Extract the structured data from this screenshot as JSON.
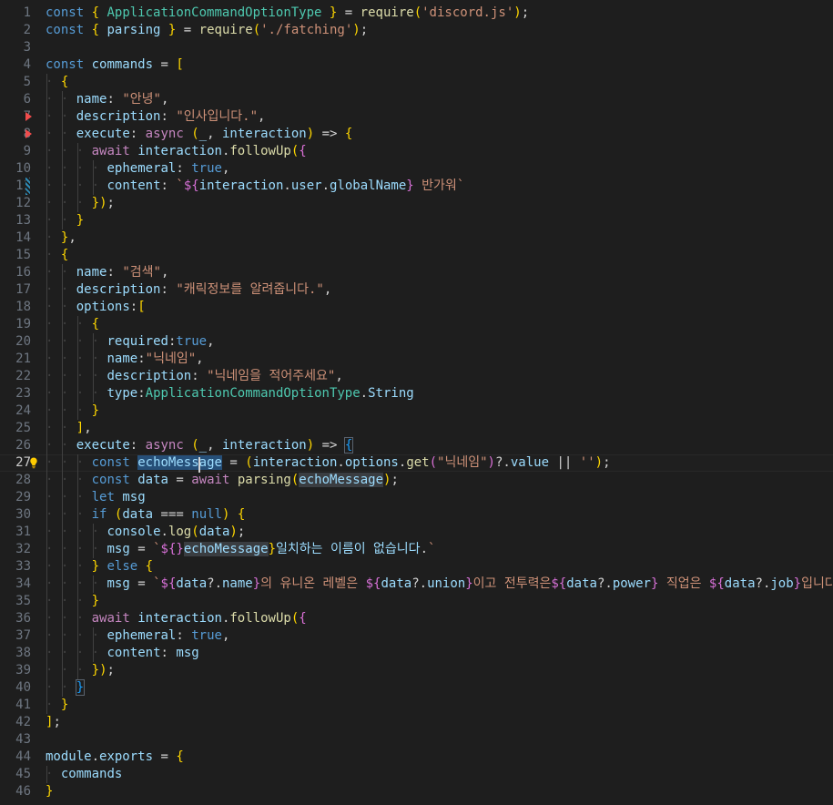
{
  "editor": {
    "name": "code-editor",
    "theme": "dark-plus",
    "background": "#1e1e1e",
    "active_line": 27,
    "total_lines": 46,
    "font_size": "14px",
    "line_height": "19px",
    "colors": {
      "background": "#1e1e1e",
      "foreground": "#d4d4d4",
      "line_number": "#6e7681",
      "active_line_number": "#cccccc",
      "keyword": "#569cd6",
      "control_keyword": "#c586c0",
      "function": "#dcdcaa",
      "class": "#4ec9b0",
      "identifier": "#9cdcfe",
      "string": "#ce9178",
      "bracket_1": "#ffd700",
      "bracket_2": "#da70d6",
      "bracket_3": "#179fff",
      "template_delimiter": "#d670d6",
      "selection": "#264f78",
      "word_match": "#3a3d41",
      "indent_guide": "#404040",
      "breakpoint_marker": "#f14c4c",
      "modified_marker": "#2d8ab5",
      "lightbulb": "#ffcc00"
    }
  },
  "gutter": {
    "markers": [
      {
        "line": 7,
        "type": "red-triangle-icon"
      },
      {
        "line": 8,
        "type": "red-triangle-icon"
      },
      {
        "line": 11,
        "type": "blue-stripe-icon"
      },
      {
        "line": 27,
        "type": "lightbulb-icon"
      }
    ]
  },
  "selection": {
    "line": 27,
    "text": "echoMessage",
    "cursor_offset_chars": 8
  },
  "word_matches": [
    {
      "line": 28,
      "text": "echoMessage"
    },
    {
      "line": 32,
      "text": "echoMessage"
    }
  ],
  "bracket_match": {
    "open": {
      "line": 26,
      "char": "{"
    },
    "close": {
      "line": 40,
      "char": "}"
    }
  },
  "code": {
    "lines": [
      {
        "n": 1,
        "text": "const { ApplicationCommandOptionType } = require('discord.js');"
      },
      {
        "n": 2,
        "text": "const { parsing } = require('./fatching');"
      },
      {
        "n": 3,
        "text": ""
      },
      {
        "n": 4,
        "text": "const commands = ["
      },
      {
        "n": 5,
        "text": "  {"
      },
      {
        "n": 6,
        "text": "    name: \"안녕\","
      },
      {
        "n": 7,
        "text": "    description: \"인사입니다.\","
      },
      {
        "n": 8,
        "text": "    execute: async (_, interaction) => {"
      },
      {
        "n": 9,
        "text": "      await interaction.followUp({"
      },
      {
        "n": 10,
        "text": "        ephemeral: true,"
      },
      {
        "n": 11,
        "text": "        content: `${interaction.user.globalName} 반가워`"
      },
      {
        "n": 12,
        "text": "      });"
      },
      {
        "n": 13,
        "text": "    }"
      },
      {
        "n": 14,
        "text": "  },"
      },
      {
        "n": 15,
        "text": "  {"
      },
      {
        "n": 16,
        "text": "    name: \"검색\","
      },
      {
        "n": 17,
        "text": "    description: \"캐릭정보를 알려줍니다.\","
      },
      {
        "n": 18,
        "text": "    options:["
      },
      {
        "n": 19,
        "text": "      {"
      },
      {
        "n": 20,
        "text": "        required:true,"
      },
      {
        "n": 21,
        "text": "        name:\"닉네임\","
      },
      {
        "n": 22,
        "text": "        description: \"닉네임을 적어주세요\","
      },
      {
        "n": 23,
        "text": "        type:ApplicationCommandOptionType.String"
      },
      {
        "n": 24,
        "text": "      }"
      },
      {
        "n": 25,
        "text": "    ],"
      },
      {
        "n": 26,
        "text": "    execute: async (_, interaction) => {"
      },
      {
        "n": 27,
        "text": "      const echoMessage = (interaction.options.get(\"닉네임\")?.value || '');"
      },
      {
        "n": 28,
        "text": "      const data = await parsing(echoMessage);"
      },
      {
        "n": 29,
        "text": "      let msg"
      },
      {
        "n": 30,
        "text": "      if (data === null) {"
      },
      {
        "n": 31,
        "text": "        console.log(data);"
      },
      {
        "n": 32,
        "text": "        msg = `${echoMessage}일치하는 이름이 없습니다.`"
      },
      {
        "n": 33,
        "text": "      } else {"
      },
      {
        "n": 34,
        "text": "        msg = `${data?.name}의 유니온 레벨은 ${data?.union}이고 전투력은${data?.power} 직업은 ${data?.job}입니다.`"
      },
      {
        "n": 35,
        "text": "      }"
      },
      {
        "n": 36,
        "text": "      await interaction.followUp({"
      },
      {
        "n": 37,
        "text": "        ephemeral: true,"
      },
      {
        "n": 38,
        "text": "        content: msg"
      },
      {
        "n": 39,
        "text": "      });"
      },
      {
        "n": 40,
        "text": "    }"
      },
      {
        "n": 41,
        "text": "  }"
      },
      {
        "n": 42,
        "text": "];"
      },
      {
        "n": 43,
        "text": ""
      },
      {
        "n": 44,
        "text": "module.exports = {"
      },
      {
        "n": 45,
        "text": "  commands"
      },
      {
        "n": 46,
        "text": "}"
      }
    ]
  }
}
